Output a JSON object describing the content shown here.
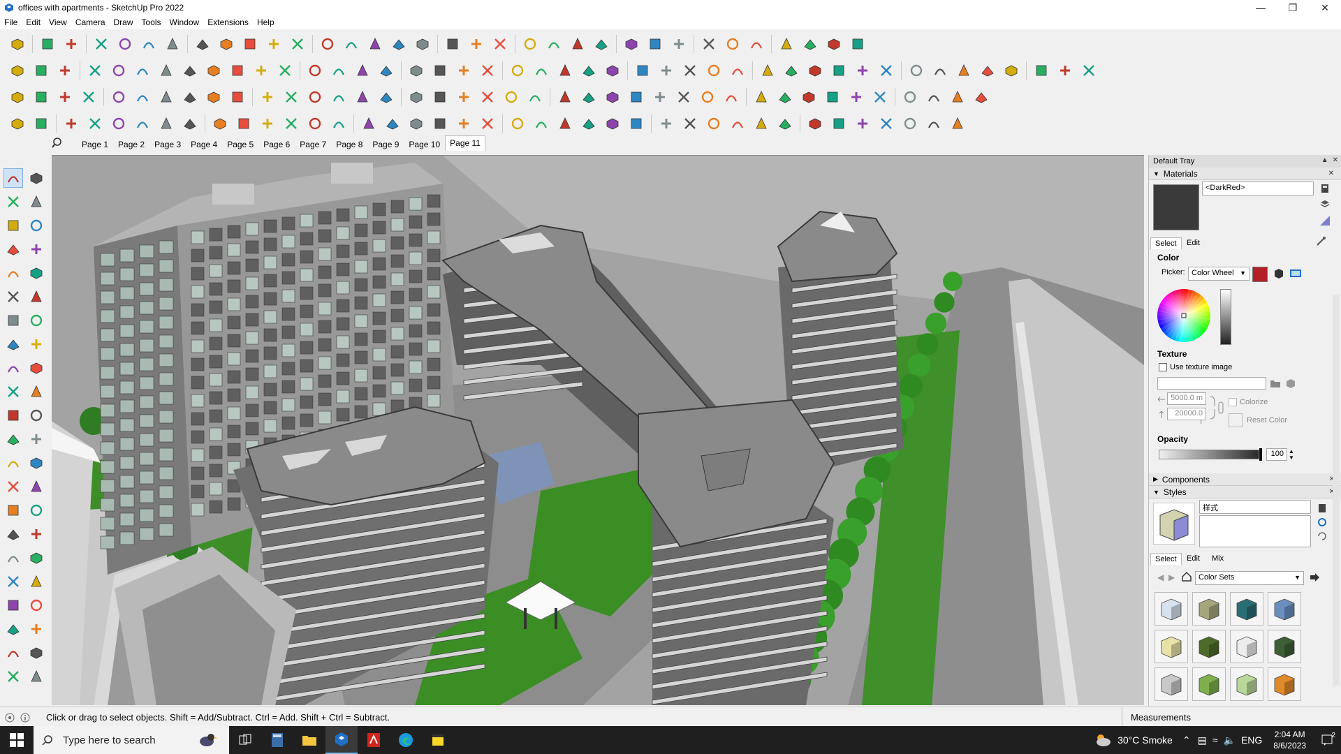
{
  "window": {
    "title": "offices with apartments - SketchUp Pro 2022",
    "controls": [
      "minimize",
      "maximize",
      "close"
    ]
  },
  "menubar": {
    "items": [
      "File",
      "Edit",
      "View",
      "Camera",
      "Draw",
      "Tools",
      "Window",
      "Extensions",
      "Help"
    ]
  },
  "scenes": {
    "tabs": [
      "Page 1",
      "Page 2",
      "Page 3",
      "Page 4",
      "Page 5",
      "Page 6",
      "Page 7",
      "Page 8",
      "Page 9",
      "Page 10",
      "Page 11"
    ],
    "active": "Page 11"
  },
  "tray": {
    "title": "Default Tray",
    "materials": {
      "header": "Materials",
      "name": "<DarkRed>",
      "tab_select": "Select",
      "tab_edit": "Edit",
      "color_label": "Color",
      "picker_label": "Picker:",
      "picker_value": "Color Wheel",
      "picker_swatch_color": "#b32026",
      "texture_label": "Texture",
      "use_texture_label": "Use texture image",
      "width_value": "5000.0 m",
      "height_value": "20000.0 r",
      "colorize_label": "Colorize",
      "reset_color_label": "Reset Color",
      "opacity_label": "Opacity",
      "opacity_value": "100"
    },
    "components": {
      "header": "Components"
    },
    "styles": {
      "header": "Styles",
      "name": "样式",
      "tab_select": "Select",
      "tab_edit": "Edit",
      "tab_mix": "Mix",
      "library": "Color Sets"
    }
  },
  "statusbar": {
    "hint": "Click or drag to select objects. Shift = Add/Subtract. Ctrl = Add. Shift + Ctrl = Subtract.",
    "measurements_label": "Measurements"
  },
  "taskbar": {
    "search_placeholder": "Type here to search",
    "weather": "30°C  Smoke",
    "language": "ENG",
    "time": "2:04 AM",
    "date": "8/6/2023",
    "notification_count": "2"
  }
}
